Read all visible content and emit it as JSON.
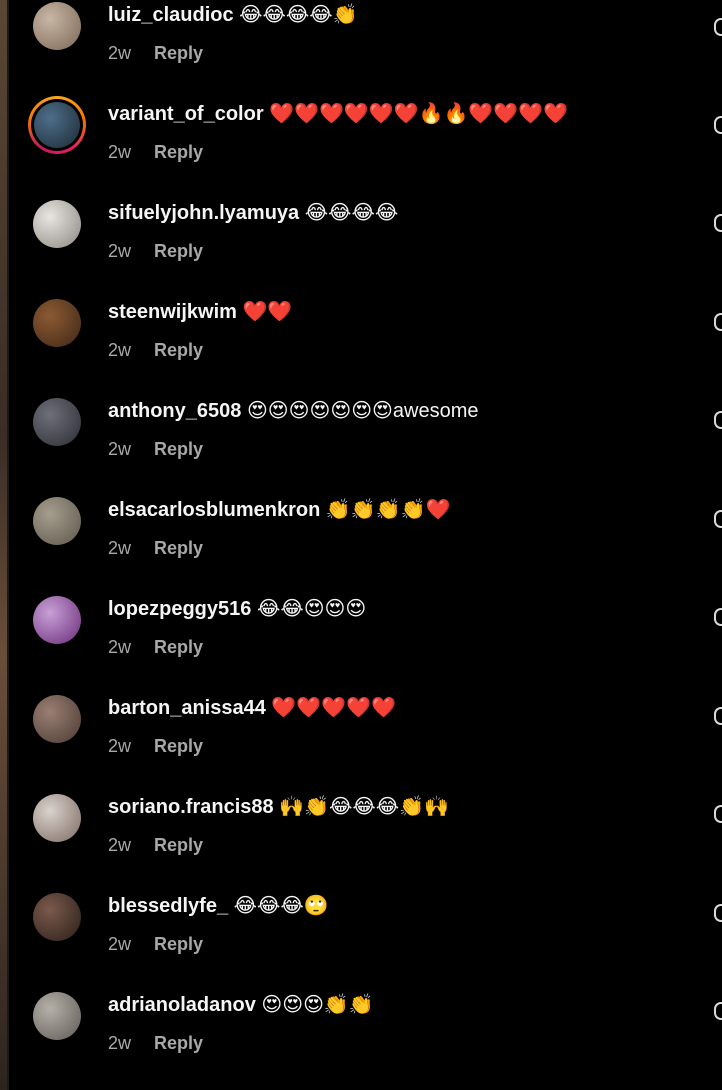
{
  "comments": [
    {
      "username": "luiz_claudioc",
      "text": "😂😂😂😂👏",
      "time": "2w",
      "reply_label": "Reply",
      "avatar_icon": "user-photo",
      "avatar_colors": [
        "#c8b7a6",
        "#7b6655"
      ],
      "story_ring": false
    },
    {
      "username": "variant_of_color",
      "text": "❤️❤️❤️❤️❤️❤️🔥🔥❤️❤️❤️❤️",
      "time": "2w",
      "reply_label": "Reply",
      "avatar_icon": "user-photo",
      "avatar_colors": [
        "#4d6e8a",
        "#1d2a33"
      ],
      "story_ring": true
    },
    {
      "username": "sifuelyjohn.lyamuya",
      "text": "😂😂😂😂",
      "time": "2w",
      "reply_label": "Reply",
      "avatar_icon": "user-photo",
      "avatar_colors": [
        "#e8e6e1",
        "#8a8580"
      ],
      "story_ring": false
    },
    {
      "username": "steenwijkwim",
      "text": "❤️❤️",
      "time": "2w",
      "reply_label": "Reply",
      "avatar_icon": "user-photo",
      "avatar_colors": [
        "#8c5a33",
        "#3e2716"
      ],
      "story_ring": false
    },
    {
      "username": "anthony_6508",
      "text": "😍😍😍😍😍😍😍awesome",
      "time": "2w",
      "reply_label": "Reply",
      "avatar_icon": "user-photo",
      "avatar_colors": [
        "#6d6f7a",
        "#2c2d33"
      ],
      "story_ring": false
    },
    {
      "username": "elsacarlosblumenkron",
      "text": "👏👏👏👏❤️",
      "time": "2w",
      "reply_label": "Reply",
      "avatar_icon": "user-photo",
      "avatar_colors": [
        "#a69e8d",
        "#5c574c"
      ],
      "story_ring": false
    },
    {
      "username": "lopezpeggy516",
      "text": "😂😂😍😍😍",
      "time": "2w",
      "reply_label": "Reply",
      "avatar_icon": "user-photo",
      "avatar_colors": [
        "#c8a0d6",
        "#6a2b7a"
      ],
      "story_ring": false
    },
    {
      "username": "barton_anissa44",
      "text": "❤️❤️❤️❤️❤️",
      "time": "2w",
      "reply_label": "Reply",
      "avatar_icon": "user-photo",
      "avatar_colors": [
        "#9a7f72",
        "#4a3a33"
      ],
      "story_ring": false
    },
    {
      "username": "soriano.francis88",
      "text": "🙌👏😂😂😂👏🙌",
      "time": "2w",
      "reply_label": "Reply",
      "avatar_icon": "user-photo",
      "avatar_colors": [
        "#d9d2cc",
        "#7d6a62"
      ],
      "story_ring": false
    },
    {
      "username": "blessedlyfe_",
      "text": "😂😂😂🙄",
      "time": "2w",
      "reply_label": "Reply",
      "avatar_icon": "user-photo",
      "avatar_colors": [
        "#7a5a4c",
        "#2a1e19"
      ],
      "story_ring": false
    },
    {
      "username": "adrianoladanov",
      "text": "😍😍😍👏👏",
      "time": "2w",
      "reply_label": "Reply",
      "avatar_icon": "user-photo",
      "avatar_colors": [
        "#b5b0a8",
        "#5e5a54"
      ],
      "story_ring": false
    }
  ],
  "colors": {
    "background": "#000000",
    "primary_text": "#f5f5f5",
    "secondary_text": "#a8a8a8"
  }
}
